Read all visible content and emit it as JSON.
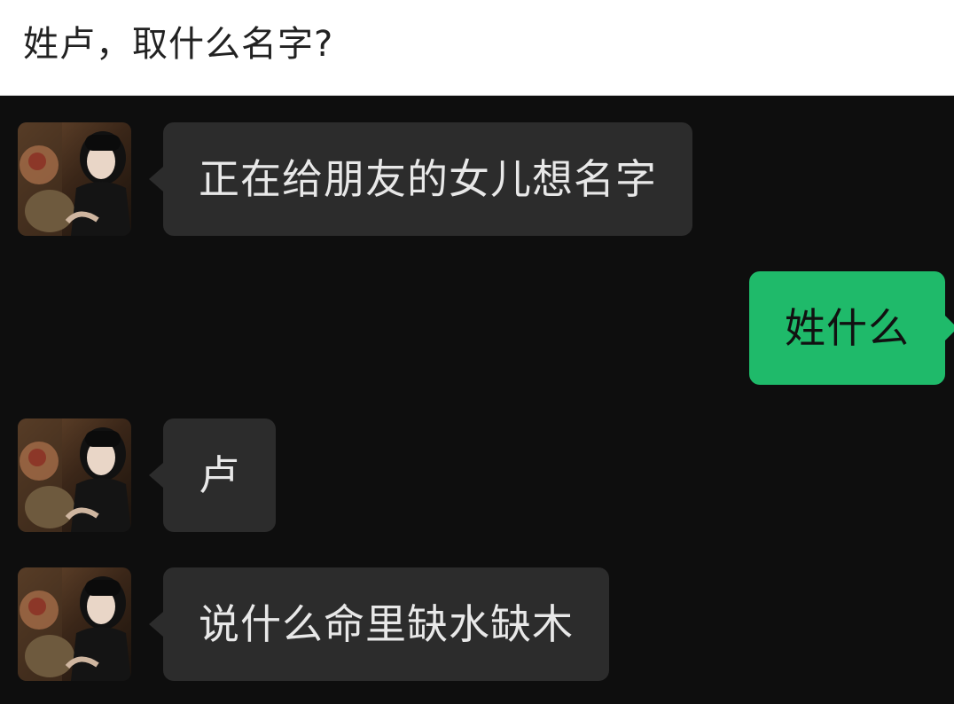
{
  "header": {
    "title": "姓卢，取什么名字?"
  },
  "colors": {
    "header_bg": "#ffffff",
    "chat_bg": "#0e0e0e",
    "incoming_bubble": "#2c2c2c",
    "outgoing_bubble": "#1fba6a"
  },
  "messages": [
    {
      "side": "incoming",
      "text": "正在给朋友的女儿想名字"
    },
    {
      "side": "outgoing",
      "text": "姓什么"
    },
    {
      "side": "incoming",
      "text": "卢"
    },
    {
      "side": "incoming",
      "text": "说什么命里缺水缺木"
    }
  ]
}
